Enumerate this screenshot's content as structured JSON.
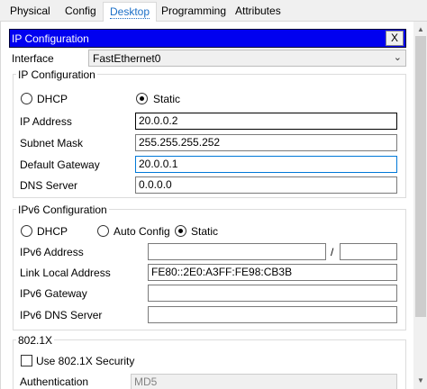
{
  "tabs": [
    {
      "label": "Physical"
    },
    {
      "label": "Config"
    },
    {
      "label": "Desktop"
    },
    {
      "label": "Programming"
    },
    {
      "label": "Attributes"
    }
  ],
  "dialog": {
    "title": "IP Configuration",
    "close_label": "X"
  },
  "interface": {
    "label": "Interface",
    "value": "FastEthernet0"
  },
  "ipv4": {
    "group_title": "IP Configuration",
    "dhcp_label": "DHCP",
    "static_label": "Static",
    "selected": "static",
    "ip_address": {
      "label": "IP Address",
      "value": "20.0.0.2"
    },
    "subnet_mask": {
      "label": "Subnet Mask",
      "value": "255.255.255.252"
    },
    "default_gateway": {
      "label": "Default Gateway",
      "value": "20.0.0.1"
    },
    "dns_server": {
      "label": "DNS Server",
      "value": "0.0.0.0"
    }
  },
  "ipv6": {
    "group_title": "IPv6 Configuration",
    "dhcp_label": "DHCP",
    "auto_config_label": "Auto Config",
    "static_label": "Static",
    "selected": "static",
    "address": {
      "label": "IPv6 Address",
      "value": "",
      "separator": "/",
      "prefix": ""
    },
    "link_local": {
      "label": "Link Local Address",
      "value": "FE80::2E0:A3FF:FE98:CB3B"
    },
    "gateway": {
      "label": "IPv6 Gateway",
      "value": ""
    },
    "dns_server": {
      "label": "IPv6 DNS Server",
      "value": ""
    }
  },
  "dot1x": {
    "group_title": "802.1X",
    "use_security_label": "Use 802.1X Security",
    "use_security_checked": false,
    "authentication": {
      "label": "Authentication",
      "value": "MD5"
    }
  },
  "icons": {
    "scroll_up": "scroll-up-arrow-icon",
    "scroll_down": "scroll-down-arrow-icon",
    "dropdown": "chevron-down-icon"
  },
  "colors": {
    "title_bar": "#0000f0",
    "active_tab": "#1c6fc7",
    "focus_border": "#0078d7"
  }
}
